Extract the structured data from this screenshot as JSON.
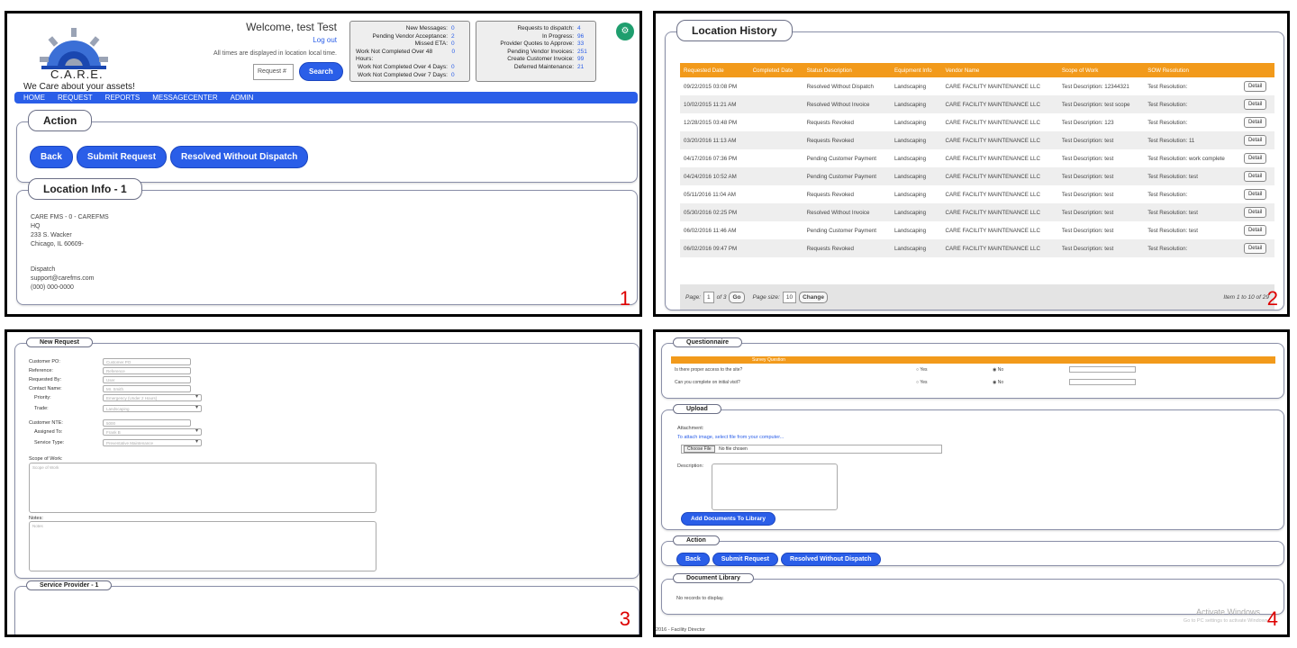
{
  "panel1": {
    "number": "1",
    "logo_name": "C.A.R.E.",
    "tagline": "We Care about your assets!",
    "welcome": "Welcome, test Test",
    "logout": "Log out",
    "timezone_note": "All times are displayed in location local time.",
    "request_placeholder": "Request #",
    "search_label": "Search",
    "stats_left": [
      {
        "label": "New Messages:",
        "value": "0"
      },
      {
        "label": "Pending Vendor Acceptance:",
        "value": "2"
      },
      {
        "label": "Missed ETA:",
        "value": "0"
      },
      {
        "label": "Work Not Completed Over 48 Hours:",
        "value": "0"
      },
      {
        "label": "Work Not Completed Over 4 Days:",
        "value": "0"
      },
      {
        "label": "Work Not Completed Over 7 Days:",
        "value": "0"
      }
    ],
    "stats_right": [
      {
        "label": "Requests to dispatch:",
        "value": "4"
      },
      {
        "label": "In Progress:",
        "value": "96"
      },
      {
        "label": "Provider Quotes to Approve:",
        "value": "33"
      },
      {
        "label": "Pending Vendor Invoices:",
        "value": "251"
      },
      {
        "label": "Create Customer Invoice:",
        "value": "99"
      },
      {
        "label": "Deferred Maintenance:",
        "value": "21"
      }
    ],
    "nav": [
      "HOME",
      "REQUEST",
      "REPORTS",
      "MESSAGECENTER",
      "ADMIN"
    ],
    "action_legend": "Action",
    "buttons": [
      "Back",
      "Submit Request",
      "Resolved Without Dispatch"
    ],
    "location_legend": "Location Info - 1",
    "address": [
      "CARE FMS - 0 - CAREFMS",
      "HQ",
      "233 S. Wacker",
      "Chicago, IL 60609-"
    ],
    "dispatch": [
      "Dispatch",
      "support@carefms.com",
      "(000) 000-0000"
    ]
  },
  "panel2": {
    "number": "2",
    "legend": "Location History",
    "columns": [
      "Requested Date",
      "Completed Date",
      "Status Description",
      "Equipment Info",
      "Vendor Name",
      "Scope of Work",
      "SOW Resolution",
      ""
    ],
    "rows": [
      [
        "09/22/2015 03:08 PM",
        "",
        "Resolved Without Dispatch",
        "Landscaping",
        "CARE FACILITY MAINTENANCE LLC",
        "Test Description: 12344321",
        "Test Resolution:"
      ],
      [
        "10/02/2015 11:21 AM",
        "",
        "Resolved Without Invoice",
        "Landscaping",
        "CARE FACILITY MAINTENANCE LLC",
        "Test Description: test scope",
        "Test Resolution:"
      ],
      [
        "12/28/2015 03:48 PM",
        "",
        "Requests Revoked",
        "Landscaping",
        "CARE FACILITY MAINTENANCE LLC",
        "Test Description: 123",
        "Test Resolution:"
      ],
      [
        "03/20/2016 11:13 AM",
        "",
        "Requests Revoked",
        "Landscaping",
        "CARE FACILITY MAINTENANCE LLC",
        "Test Description: test",
        "Test Resolution: 11"
      ],
      [
        "04/17/2016 07:36 PM",
        "",
        "Pending Customer Payment",
        "Landscaping",
        "CARE FACILITY MAINTENANCE LLC",
        "Test Description: test",
        "Test Resolution: work complete"
      ],
      [
        "04/24/2016 10:52 AM",
        "",
        "Pending Customer Payment",
        "Landscaping",
        "CARE FACILITY MAINTENANCE LLC",
        "Test Description: test",
        "Test Resolution: test"
      ],
      [
        "05/11/2016 11:04 AM",
        "",
        "Requests Revoked",
        "Landscaping",
        "CARE FACILITY MAINTENANCE LLC",
        "Test Description: test",
        "Test Resolution:"
      ],
      [
        "05/30/2016 02:25 PM",
        "",
        "Resolved Without Invoice",
        "Landscaping",
        "CARE FACILITY MAINTENANCE LLC",
        "Test Description: test",
        "Test Resolution: test"
      ],
      [
        "06/02/2016 11:46 AM",
        "",
        "Pending Customer Payment",
        "Landscaping",
        "CARE FACILITY MAINTENANCE LLC",
        "Test Description: test",
        "Test Resolution: test"
      ],
      [
        "06/02/2016 09:47 PM",
        "",
        "Requests Revoked",
        "Landscaping",
        "CARE FACILITY MAINTENANCE LLC",
        "Test Description: test",
        "Test Resolution:"
      ]
    ],
    "detail_label": "Detail",
    "pager": {
      "page_label": "Page:",
      "page": "1",
      "of": "of 3",
      "go": "Go",
      "size_label": "Page size:",
      "size": "10",
      "change": "Change",
      "info": "Item 1 to 10 of 29"
    }
  },
  "panel3": {
    "number": "3",
    "legend": "New Request",
    "fields": [
      {
        "label": "Customer PO:",
        "value": "Customer PO"
      },
      {
        "label": "Reference:",
        "value": "Reference"
      },
      {
        "label": "Requested By:",
        "value": "User"
      },
      {
        "label": "Contact Name:",
        "value": "Mr. Smith"
      },
      {
        "label": "Priority:",
        "value": "Emergency (Under 2 Hours)"
      },
      {
        "label": "Trade:",
        "value": "Landscaping"
      },
      {
        "label": "Customer NTE:",
        "value": "5000"
      },
      {
        "label": "Assigned To:",
        "value": "Frank B"
      },
      {
        "label": "Service Type:",
        "value": "Preventative Maintenance"
      }
    ],
    "scope_label": "Scope of Work:",
    "scope_placeholder": "Scope of Work",
    "notes_label": "Notes:",
    "notes_placeholder": "Notes",
    "sp_legend": "Service Provider - 1"
  },
  "panel4": {
    "number": "4",
    "q_legend": "Questionnaire",
    "q_header": "Survey Question",
    "questions": [
      "Is there proper access to the site?",
      "Can you complete on initial visit?"
    ],
    "yes": "Yes",
    "no": "No",
    "upload_legend": "Upload",
    "attachment": "Attachment:",
    "attach_hint": "To attach image, select file from your computer...",
    "choose_file": "Choose File",
    "no_file": "No file chosen",
    "description": "Description:",
    "add_docs": "Add Documents To Library",
    "action_legend": "Action",
    "buttons": [
      "Back",
      "Submit Request",
      "Resolved Without Dispatch"
    ],
    "doclib_legend": "Document Library",
    "no_records": "No records to display.",
    "watermark": "Activate Windows",
    "watermark_sub": "Go to PC settings to activate Windows.",
    "footer": "2016 - Facility Director"
  },
  "colors": {
    "accent": "#2a5ee8",
    "table_header": "#f29a1b",
    "panel_number": "#dd0000"
  }
}
